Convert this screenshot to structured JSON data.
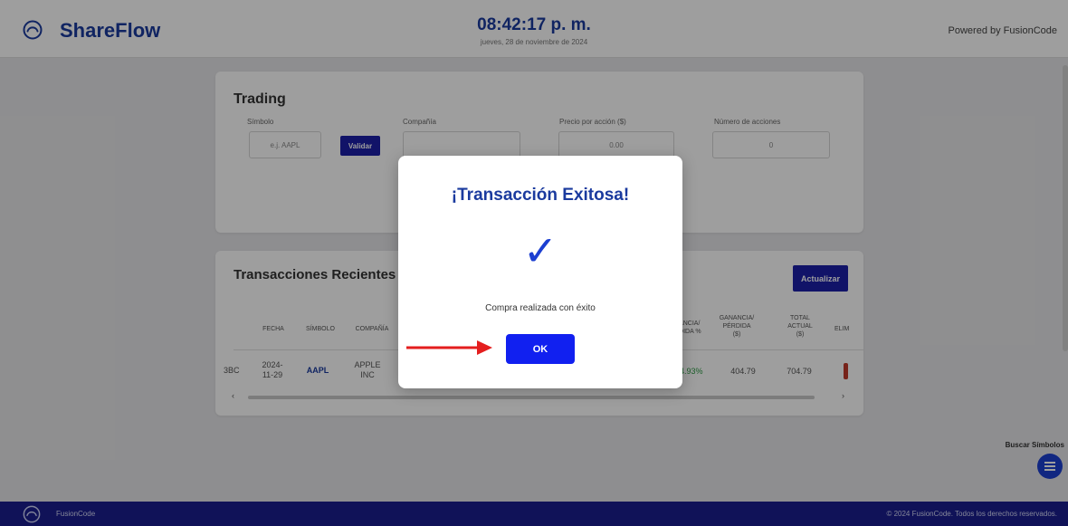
{
  "header": {
    "brand": "ShareFlow",
    "clock": "08:42:17 p. m.",
    "date": "jueves, 28 de noviembre de 2024",
    "powered_by": "Powered by FusionCode"
  },
  "trading": {
    "title": "Trading",
    "fields": {
      "symbol_label": "Símbolo",
      "symbol_placeholder": "e.j. AAPL",
      "validate_label": "Validar",
      "company_label": "Compañía",
      "company_value": "",
      "price_label": "Precio por acción ($)",
      "price_value": "0.00",
      "shares_label": "Número de acciones",
      "shares_value": "0"
    }
  },
  "transactions": {
    "title": "Transacciones Recientes",
    "refresh_label": "Actualizar",
    "headers": {
      "fecha": "FECHA",
      "simbolo": "SÍMBOLO",
      "compania": "COMPAÑÍA",
      "ganancia_pct": "NANCIA/ RDIDA %",
      "ganancia_usd": "GANANCIA/ PÉRDIDA ($)",
      "total_actual": "TOTAL ACTUAL ($)",
      "eliminar": "ELIM"
    },
    "rows": [
      {
        "id_fragment": "3BC",
        "fecha": "2024- 11-29",
        "simbolo": "AAPL",
        "compania": "APPLE INC",
        "ganancia_pct": "34.93%",
        "ganancia_usd": "404.79",
        "total_actual": "704.79"
      }
    ],
    "scroll_left": "‹",
    "scroll_right": "›"
  },
  "side": {
    "search_symbols": "Buscar Símbolos",
    "fab_icon": "menu-icon"
  },
  "footer": {
    "brand": "FusionCode",
    "copyright": "© 2024 FusionCode. Todos los derechos reservados."
  },
  "modal": {
    "title": "¡Transacción Exitosa!",
    "check": "✓",
    "message": "Compra realizada con éxito",
    "ok_label": "OK"
  },
  "colors": {
    "brand": "#1a3a9e",
    "primary_button": "#1c1fa8",
    "ok_button": "#1120f0",
    "footer": "#1a1e8f",
    "profit": "#2e9a44",
    "arrow": "#e41e1e"
  }
}
